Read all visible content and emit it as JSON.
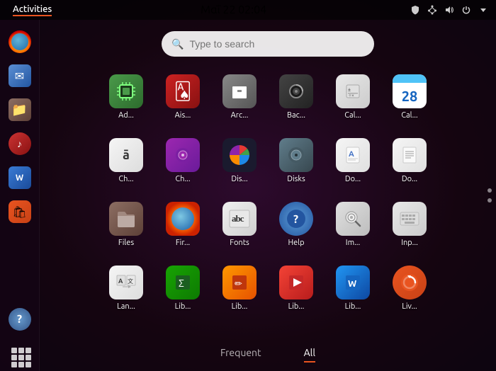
{
  "topbar": {
    "activities_label": "Activities",
    "datetime": "Μαΐ 22  02:04",
    "icons": [
      "shield",
      "network",
      "volume",
      "power",
      "settings"
    ]
  },
  "search": {
    "placeholder": "Type to search"
  },
  "apps": [
    {
      "id": "ad",
      "label": "Ad...",
      "icon": "cpu",
      "icon_char": "⬛"
    },
    {
      "id": "ais",
      "label": "Ais...",
      "icon": "aisleriot",
      "icon_char": "🂡"
    },
    {
      "id": "arc",
      "label": "Arc...",
      "icon": "archive",
      "icon_char": "📦"
    },
    {
      "id": "bac",
      "label": "Bac...",
      "icon": "backup",
      "icon_char": "⏺"
    },
    {
      "id": "cal1",
      "label": "Cal...",
      "icon": "calc",
      "icon_char": "±"
    },
    {
      "id": "cal2",
      "label": "Cal...",
      "icon": "calendar",
      "icon_char": "28"
    },
    {
      "id": "ch1",
      "label": "Ch...",
      "icon": "charmap",
      "icon_char": "ā"
    },
    {
      "id": "ch2",
      "label": "Ch...",
      "icon": "cheese",
      "icon_char": "◎"
    },
    {
      "id": "dis1",
      "label": "Dis...",
      "icon": "disks-usage",
      "icon_char": "◕"
    },
    {
      "id": "disks",
      "label": "Disks",
      "icon": "disks",
      "icon_char": "💿"
    },
    {
      "id": "do1",
      "label": "Do...",
      "icon": "docs",
      "icon_char": "A"
    },
    {
      "id": "do2",
      "label": "Do...",
      "icon": "docviewer",
      "icon_char": "📄"
    },
    {
      "id": "files",
      "label": "Files",
      "icon": "files",
      "icon_char": "📁"
    },
    {
      "id": "fir",
      "label": "Fir...",
      "icon": "firefox",
      "icon_char": "🦊"
    },
    {
      "id": "fonts",
      "label": "Fonts",
      "icon": "fonts",
      "icon_char": "abc"
    },
    {
      "id": "help",
      "label": "Help",
      "icon": "help",
      "icon_char": "?"
    },
    {
      "id": "im",
      "label": "Im...",
      "icon": "imgviewer",
      "icon_char": "🔍"
    },
    {
      "id": "inp",
      "label": "Inp...",
      "icon": "input",
      "icon_char": "⌨"
    },
    {
      "id": "lan",
      "label": "Lan...",
      "icon": "lang",
      "icon_char": "A文"
    },
    {
      "id": "lib1",
      "label": "Lib...",
      "icon": "libreoffice",
      "icon_char": "Σ"
    },
    {
      "id": "lib2",
      "label": "Lib...",
      "icon": "libdraw",
      "icon_char": "✏"
    },
    {
      "id": "lib3",
      "label": "Lib...",
      "icon": "libimpress",
      "icon_char": "▶"
    },
    {
      "id": "lib4",
      "label": "Lib...",
      "icon": "libwriter",
      "icon_char": "W"
    },
    {
      "id": "liv",
      "label": "Liv...",
      "icon": "livepatch",
      "icon_char": "↺"
    }
  ],
  "tabs": [
    {
      "id": "frequent",
      "label": "Frequent",
      "active": false
    },
    {
      "id": "all",
      "label": "All",
      "active": true
    }
  ],
  "dock": {
    "items": [
      {
        "id": "firefox",
        "label": "Firefox"
      },
      {
        "id": "mail",
        "label": "Mail"
      },
      {
        "id": "files",
        "label": "Files"
      },
      {
        "id": "rhythmbox",
        "label": "Rhythmbox"
      },
      {
        "id": "writer",
        "label": "Writer"
      },
      {
        "id": "appstore",
        "label": "App Store"
      },
      {
        "id": "help",
        "label": "Help"
      },
      {
        "id": "apps",
        "label": "All Apps"
      }
    ]
  },
  "colors": {
    "accent": "#e95420",
    "topbar_bg": "rgba(0,0,0,0.6)",
    "dock_bg": "rgba(20,5,20,0.85)"
  }
}
